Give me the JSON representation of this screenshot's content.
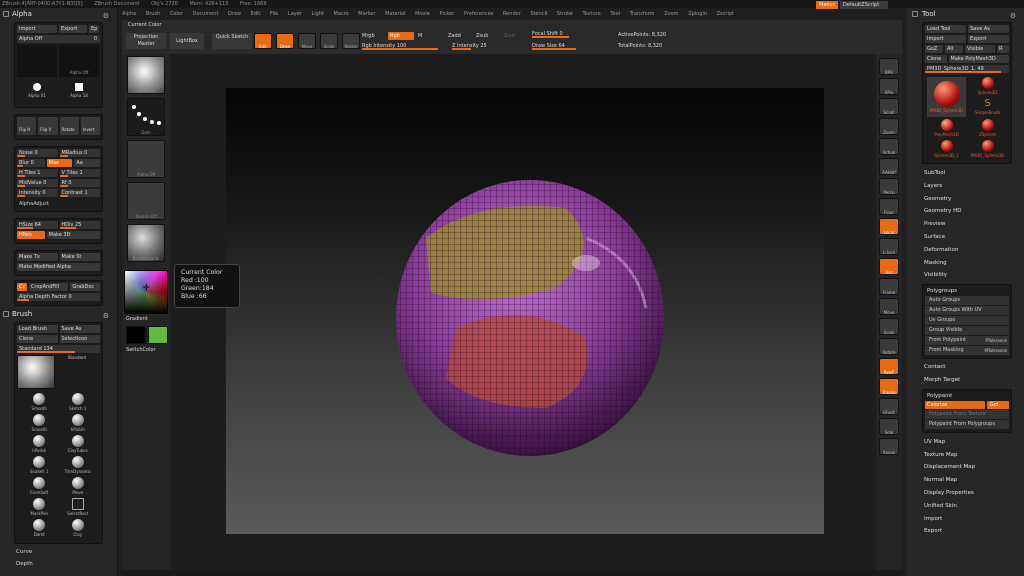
{
  "titlebar": [
    "ZBrush 4[ART-0400-A7Y1-N3Q5]",
    "ZBrush Document",
    "Obj's 2720",
    "Mem: 426+113",
    "Free: 1669"
  ],
  "menus": [
    "Alpha",
    "Brush",
    "Color",
    "Document",
    "Draw",
    "Edit",
    "File",
    "Layer",
    "Light",
    "Macro",
    "Marker",
    "Material",
    "Movie",
    "Picker",
    "Preferences",
    "Render",
    "Stencil",
    "Stroke",
    "Texture",
    "Tool",
    "Transform",
    "Zoom",
    "Zplugin",
    "Zscript"
  ],
  "menus_button": "Menus",
  "default_script": "DefaultZScript",
  "alpha_panel": {
    "title": "Alpha",
    "import": "Import",
    "export": "Export",
    "ep": "Ep",
    "alpha_off": "Alpha Off",
    "alpha_off_num": "0",
    "thumbs": [
      "Alpha Off",
      "Alpha 01",
      "Alpha 58",
      "Alpha 03"
    ],
    "flips": [
      "Flip H",
      "Flip V",
      "Rotate",
      "Invert"
    ],
    "sliders": [
      [
        "Noise 0",
        "MRadius 0"
      ],
      [
        "Blur 0",
        "Max",
        "Aa"
      ],
      [
        "H Tiles 1",
        "V Tiles 1"
      ],
      [
        "MidValue 0",
        "Rf 0"
      ],
      [
        "Intensity 0",
        "Contrast 1"
      ]
    ],
    "alpha_adjust": "AlphaAdjust",
    "hsize": "HSize 64",
    "hdiv": "HDiv 25",
    "hres": "HRes",
    "make3d": "Make 3D",
    "make_tx": "Make Tx",
    "make_st": "Make St",
    "make_modified": "Make Modified Alpha",
    "cc": "Cc",
    "grab_doc": "GrabDoc",
    "grab_label": "CropAndFill",
    "depth_factor": "Alpha Depth Factor 0"
  },
  "brush_panel": {
    "title": "Brush",
    "load": "Load Brush",
    "save": "Save As",
    "clone": "Clone",
    "select_icon": "SelectIcon",
    "current": "Standard 134",
    "brushes": [
      "Standard",
      "Standard",
      "Smooth",
      "Sketch 1",
      "Smooth",
      "hPolish",
      "hPolish",
      "ClayTubes",
      "Snakeh 1",
      "TrimDynamic",
      "FormSoft",
      "Move",
      "MaskPen",
      "SelectRect",
      "Darkt",
      "Clay"
    ],
    "curve": "Curve",
    "depth": "Depth"
  },
  "toolbar": {
    "current_color": "Current Color",
    "projection_master": "Projection Master",
    "lightbox": "LightBox",
    "quick_sketch": "Quick Sketch",
    "edit": "Edit",
    "draw": "Draw",
    "move": "Move",
    "scale": "Scale",
    "rotate": "Rotate",
    "mrgb": "Mrgb",
    "rgb": "Rgb",
    "m": "M",
    "zadd": "Zadd",
    "zsub": "Zsub",
    "zcut": "Zcut",
    "rgb_intensity": "Rgb Intensity 100",
    "z_intensity": "Z Intensity 25",
    "focal_shift": "Focal Shift 0",
    "draw_size": "Draw Size 64",
    "active_points": "ActivePoints: 8,320",
    "total_points": "TotalPoints: 8,320"
  },
  "shelf_left": [
    "Standard",
    "Dots",
    "Alpha Off",
    "Texture Off",
    "BasicMaterial"
  ],
  "color_popup": {
    "title": "Current Color",
    "red": "Red :100",
    "green": "Green:184",
    "blue": "Blue :66"
  },
  "picker": {
    "gradient": "Gradient",
    "switch": "SwitchColor",
    "main": "#000000",
    "secondary": "#66b842"
  },
  "shelf_right": [
    "BPR",
    "SPix",
    "Scroll",
    "Zoom",
    "Actual",
    "AAHalf",
    "Persp",
    "Floor",
    "Local",
    "L.Sym",
    "Xyz",
    "Frame",
    "Move",
    "Scale",
    "Rotate",
    "PolyF",
    "Transp",
    "Ghost",
    "Solo",
    "Xpose"
  ],
  "tool_panel": {
    "title": "Tool",
    "load": "Load Tool",
    "save": "Save As",
    "import": "Import",
    "export": "Export",
    "goz": "GoZ",
    "all": "All",
    "visible": "Visible",
    "r": "R",
    "clone": "Clone",
    "make_polymesh": "Make PolyMesh3D",
    "current": "PM3D_Sphere3D_1. 49",
    "tools": [
      "PM3D_Sphere3D",
      "Sphere3D",
      "PM3D_Sphere3D",
      "SimpleBrush",
      "PolyMesh3D",
      "ZSphere",
      "Sphere3D_1",
      "PM3D_Sphere3D"
    ],
    "subpanels": [
      "SubTool",
      "Layers",
      "Geometry",
      "Geometry HD",
      "Preview",
      "Surface",
      "Deformation",
      "Masking",
      "Visibility"
    ],
    "polygroups_header": "Polygroups",
    "polygroups": [
      "Auto Groups",
      "Auto Groups With UV",
      "Uv Groups",
      "Group Visible",
      "From Polypaint",
      "From Masking"
    ],
    "ptoler": "PTolerance",
    "mtoler": "MTolerance",
    "after_poly": [
      "Contact",
      "Morph Target"
    ],
    "polypaint_header": "Polypaint",
    "colorize": "Colorize",
    "grd": "Grd",
    "from_texture": "Polypaint From Texture",
    "from_polygroups": "Polypaint From Polygroups",
    "bottom": [
      "UV Map",
      "Texture Map",
      "Displacement Map",
      "Normal Map",
      "Display Properties",
      "Unified Skin",
      "Import",
      "Export"
    ]
  },
  "colors": {
    "accent": "#e86a12",
    "sphere": "#8a3a9a"
  }
}
